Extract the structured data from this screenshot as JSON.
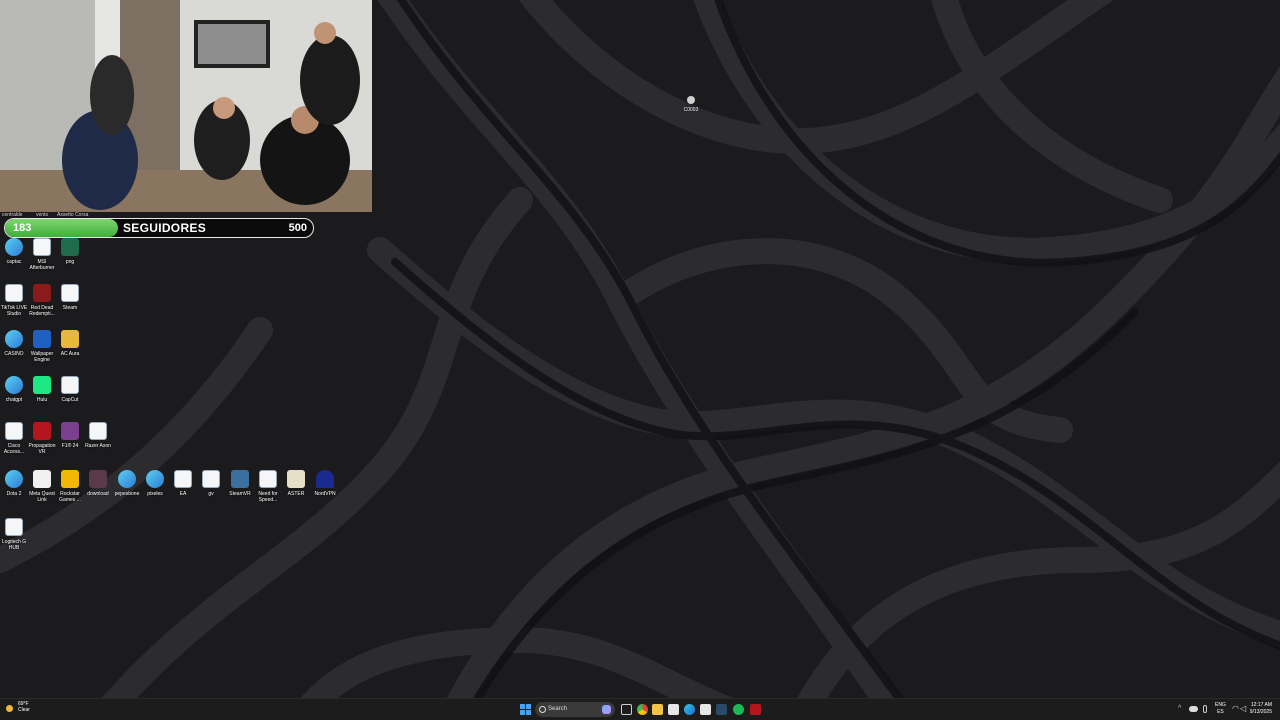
{
  "goal": {
    "current": "183",
    "label": "SEGUIDORES",
    "target": "500",
    "progress_fraction": 0.366
  },
  "partial_labels": [
    "centralde",
    "vents",
    "Assetto Corsa"
  ],
  "desktop_icons": [
    {
      "id": "captac",
      "label": "captac",
      "icon": "edge-icon",
      "color": "#2d7bd6"
    },
    {
      "id": "msi",
      "label": "MSI Afterburner",
      "icon": "app-icon",
      "color": "#e8e8e8"
    },
    {
      "id": "png",
      "label": "png",
      "icon": "image-icon",
      "color": "#1f6b4a"
    },
    {
      "id": "tiktok",
      "label": "TikTok LIVE Studio",
      "icon": "app-icon",
      "color": "#e8e8e8"
    },
    {
      "id": "rdr",
      "label": "Red Dead Redempti...",
      "icon": "rdr-icon",
      "color": "#8b1b1b"
    },
    {
      "id": "steam",
      "label": "Steam",
      "icon": "app-icon",
      "color": "#e8e8e8"
    },
    {
      "id": "casino",
      "label": "CASINO",
      "icon": "edge-icon",
      "color": "#2d7bd6"
    },
    {
      "id": "wallpaper",
      "label": "Wallpaper Engine",
      "icon": "wallpaper-engine-icon",
      "color": "#1f5fbf"
    },
    {
      "id": "acaura",
      "label": "AC Aura",
      "icon": "folder-icon",
      "color": "#e8b83a"
    },
    {
      "id": "chatgpt",
      "label": "chatgpt",
      "icon": "edge-icon",
      "color": "#2d7bd6"
    },
    {
      "id": "hulu",
      "label": "Hulu",
      "icon": "hulu-icon",
      "color": "#1ce783"
    },
    {
      "id": "capcut",
      "label": "CapCut",
      "icon": "app-icon",
      "color": "#e8e8e8"
    },
    {
      "id": "cisco",
      "label": "Cisco Access...",
      "icon": "app-icon",
      "color": "#e8e8e8"
    },
    {
      "id": "propagation",
      "label": "Propagation VR",
      "icon": "propagation-icon",
      "color": "#b5161d"
    },
    {
      "id": "f124",
      "label": "F1® 24",
      "icon": "game-icon",
      "color": "#7b3f8f"
    },
    {
      "id": "razer",
      "label": "Razer Axon",
      "icon": "app-icon",
      "color": "#e8e8e8"
    },
    {
      "id": "dota2",
      "label": "Dota 2",
      "icon": "edge-icon",
      "color": "#2d7bd6"
    },
    {
      "id": "metaquest",
      "label": "Meta Quest Link",
      "icon": "meta-icon",
      "color": "#f0f0f0"
    },
    {
      "id": "rockstar",
      "label": "Rockstar Games ...",
      "icon": "rockstar-icon",
      "color": "#f2b705"
    },
    {
      "id": "download",
      "label": "download",
      "icon": "image-icon",
      "color": "#5a3a4a"
    },
    {
      "id": "pepesbone",
      "label": "pepesbone",
      "icon": "edge-icon",
      "color": "#2d7bd6"
    },
    {
      "id": "pixeles",
      "label": "pixeles",
      "icon": "edge-icon",
      "color": "#2d7bd6"
    },
    {
      "id": "ea",
      "label": "EA",
      "icon": "app-icon",
      "color": "#e8e8e8"
    },
    {
      "id": "gv",
      "label": "gv",
      "icon": "app-icon",
      "color": "#e8e8e8"
    },
    {
      "id": "steamvr",
      "label": "SteamVR",
      "icon": "steamvr-icon",
      "color": "#3a6fa0"
    },
    {
      "id": "nfs",
      "label": "Need for Speed...",
      "icon": "app-icon",
      "color": "#e8e8e8"
    },
    {
      "id": "aster",
      "label": "ASTER",
      "icon": "aster-icon",
      "color": "#e6dfc8"
    },
    {
      "id": "nordvpn",
      "label": "NordVPN",
      "icon": "nordvpn-icon",
      "color": "#4a6cf7"
    },
    {
      "id": "logitech",
      "label": "Logitech G HUB",
      "icon": "app-icon",
      "color": "#e8e8e8"
    },
    {
      "id": "c0003",
      "label": "C0003",
      "icon": "small-file-icon",
      "color": "#cfcfcf"
    }
  ],
  "taskbar": {
    "weather_temp": "69°F",
    "weather_text": "Clear",
    "search_placeholder": "Search",
    "lang_top": "ENG",
    "lang_bottom": "ES",
    "time": "12:17 AM",
    "date": "9/13/2025",
    "colors": {
      "background": "#1c1c1c",
      "windows_logo": "#4aa3f0"
    }
  }
}
